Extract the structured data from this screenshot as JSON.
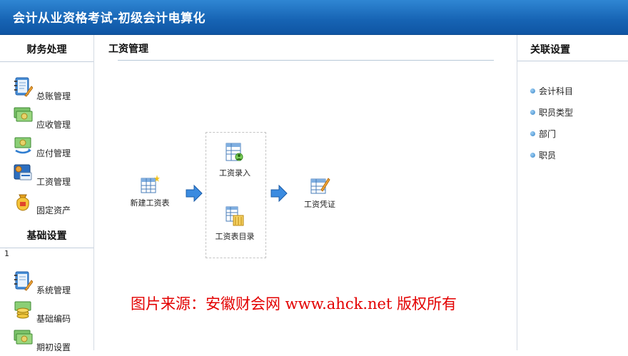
{
  "app": {
    "title": "会计从业资格考试-初级会计电算化"
  },
  "left_panel": {
    "finance": {
      "title": "财务处理",
      "items": [
        {
          "label": "总账管理",
          "icon": "ledger-notebook-icon"
        },
        {
          "label": "应收管理",
          "icon": "money-bills-icon"
        },
        {
          "label": "应付管理",
          "icon": "money-cycle-icon"
        },
        {
          "label": "工资管理",
          "icon": "wallet-card-icon"
        },
        {
          "label": "固定资产",
          "icon": "gold-bag-icon"
        }
      ]
    },
    "basic": {
      "title": "基础设置",
      "stray_text": "1",
      "items": [
        {
          "label": "系统管理",
          "icon": "notebook-pen-icon"
        },
        {
          "label": "基础编码",
          "icon": "coin-stack-icon"
        },
        {
          "label": "期初设置",
          "icon": "money-bills-icon"
        }
      ]
    }
  },
  "main": {
    "title": "工资管理",
    "flow": {
      "new_table": "新建工资表",
      "entry": "工资录入",
      "directory": "工资表目录",
      "voucher": "工资凭证"
    }
  },
  "right_panel": {
    "title": "关联设置",
    "links": [
      "会计科目",
      "职员类型",
      "部门",
      "职员"
    ]
  },
  "watermark": "图片来源：安徽财会网 www.ahck.net 版权所有",
  "colors": {
    "header": "#1663b3",
    "watermark": "#e30000",
    "link_dot": "#3a86c8"
  }
}
